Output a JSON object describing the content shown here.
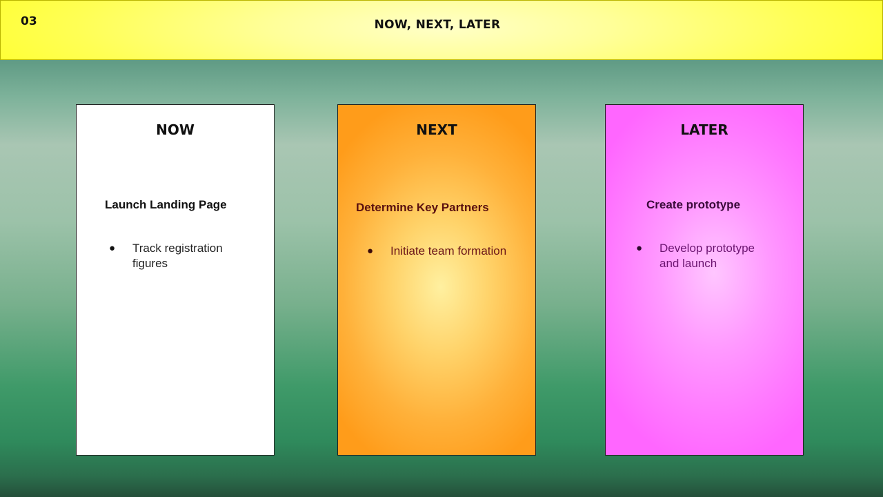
{
  "slide": {
    "number": "03",
    "title": "NOW, NEXT, LATER"
  },
  "cards": [
    {
      "heading": "NOW",
      "item_title": "Launch Landing Page",
      "bullet": "Track registration figures",
      "color": "#ffffff"
    },
    {
      "heading": "NEXT",
      "item_title": "Determine Key Partners",
      "bullet": "Initiate team formation",
      "color": "#ffa32a"
    },
    {
      "heading": "LATER",
      "item_title": "Create prototype",
      "bullet": "Develop prototype and launch",
      "color": "#ff7aff"
    }
  ],
  "colors": {
    "header_background": "#ffff66",
    "slide_background": "#4f9a74"
  }
}
